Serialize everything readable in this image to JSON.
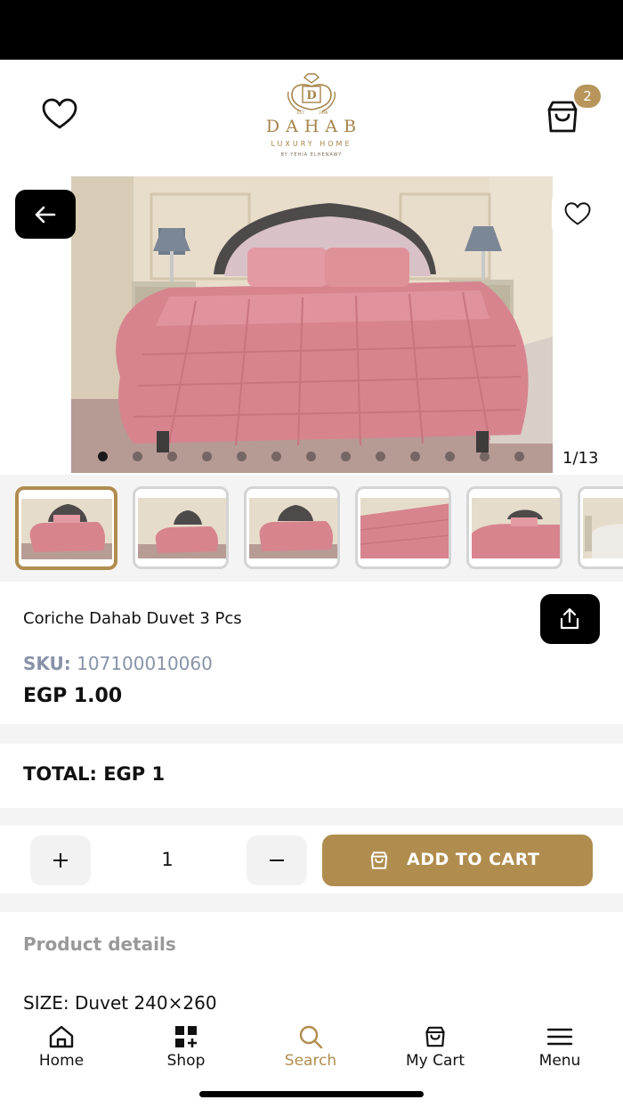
{
  "header": {
    "brand": "DAHAB",
    "sub": "LUXURY HOME",
    "by": "BY YEHIA ELHENAWY",
    "cart_count": "2",
    "colors": {
      "gold": "#b08d4f"
    }
  },
  "gallery": {
    "counter": "1/13",
    "total_images": 13,
    "active_index": 0
  },
  "product": {
    "title": "Coriche Dahab Duvet 3 Pcs",
    "sku_label": "SKU:",
    "sku_value": "107100010060",
    "price": "EGP 1.00"
  },
  "total": {
    "text": "TOTAL: EGP 1"
  },
  "quantity": {
    "value": "1"
  },
  "add_to_cart": {
    "label": "ADD TO CART"
  },
  "details": {
    "heading": "Product details",
    "size": "SIZE: Duvet 240×260"
  },
  "tabs": [
    {
      "label": "Home",
      "icon": "home-icon"
    },
    {
      "label": "Shop",
      "icon": "grid-plus-icon"
    },
    {
      "label": "Search",
      "icon": "search-icon",
      "active": true
    },
    {
      "label": "My Cart",
      "icon": "cart-icon"
    },
    {
      "label": "Menu",
      "icon": "menu-icon"
    }
  ]
}
